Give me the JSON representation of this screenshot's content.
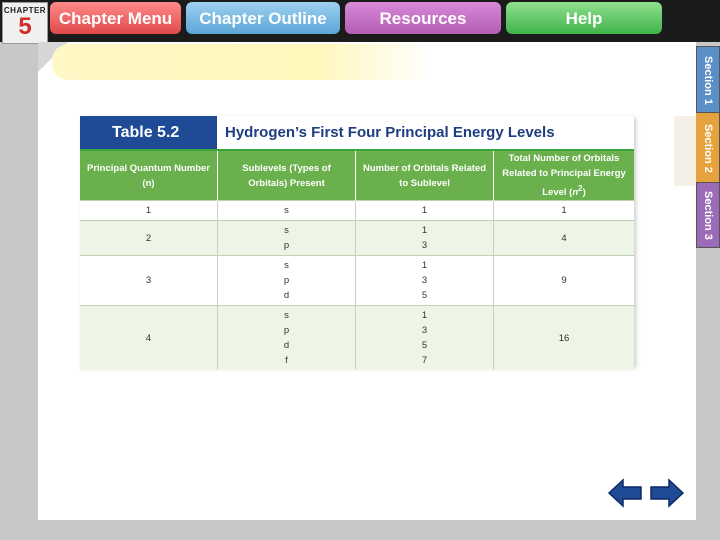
{
  "topbar": {
    "chapter_label": "CHAPTER",
    "chapter_number": "5",
    "tabs": [
      {
        "label": "Chapter Menu"
      },
      {
        "label": "Chapter Outline"
      },
      {
        "label": "Resources"
      },
      {
        "label": "Help"
      }
    ]
  },
  "side_tabs": [
    {
      "label": "Section 1"
    },
    {
      "label": "Section 2"
    },
    {
      "label": "Section 3"
    }
  ],
  "table": {
    "number": "Table 5.2",
    "title": "Hydrogen’s First Four Principal Energy Levels",
    "headers": [
      "Principal Quantum Number (n)",
      "Sublevels (Types of Orbitals) Present",
      "Number of Orbitals Related to Sublevel",
      "Total Number of Orbitals Related to Principal Energy Level (n²)"
    ],
    "rows": [
      {
        "n": "1",
        "sublevels": [
          "s"
        ],
        "orbitals": [
          "1"
        ],
        "total": "1"
      },
      {
        "n": "2",
        "sublevels": [
          "s",
          "p"
        ],
        "orbitals": [
          "1",
          "3"
        ],
        "total": "4"
      },
      {
        "n": "3",
        "sublevels": [
          "s",
          "p",
          "d"
        ],
        "orbitals": [
          "1",
          "3",
          "5"
        ],
        "total": "9"
      },
      {
        "n": "4",
        "sublevels": [
          "s",
          "p",
          "d",
          "f"
        ],
        "orbitals": [
          "1",
          "3",
          "5",
          "7"
        ],
        "total": "16"
      }
    ]
  },
  "nav": {
    "prev_icon": "left-arrow-icon",
    "next_icon": "right-arrow-icon"
  },
  "colors": {
    "table_header_bg": "#6ab04c",
    "table_number_bg": "#1e4a96",
    "title_color": "#1e3d82",
    "arrow_color": "#1e4a96"
  }
}
